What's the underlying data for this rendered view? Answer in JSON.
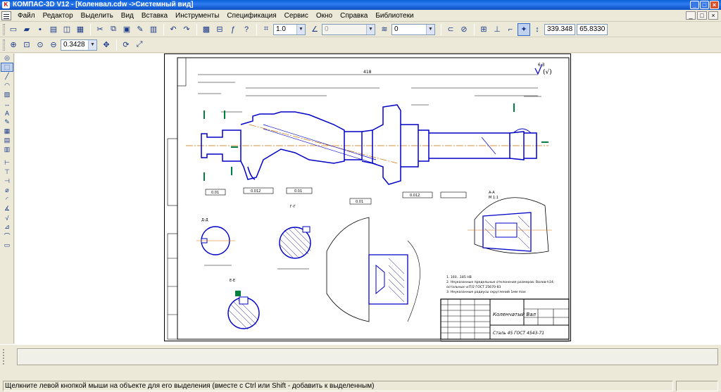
{
  "window": {
    "title": "КОМПАС-3D V12 - [Коленвал.cdw ->Системный вид]",
    "controls": [
      "_",
      "□",
      "×"
    ]
  },
  "menubar": {
    "items": [
      "Файл",
      "Редактор",
      "Выделить",
      "Вид",
      "Вставка",
      "Инструменты",
      "Спецификация",
      "Сервис",
      "Окно",
      "Справка",
      "Библиотеки"
    ]
  },
  "toolbar1": {
    "step_value": "1.0",
    "disabled_value": "0",
    "layer_value": "0",
    "coord_x": "339.348",
    "coord_y": "65.8330"
  },
  "toolbar2": {
    "zoom_value": "0.3428"
  },
  "drawing": {
    "title": "Коленчатый Вал",
    "material": "Сталь 45 ГОСТ 4543-71",
    "roughness": "6,3",
    "overall_length": "418",
    "notes": [
      "1. 160...185 HB",
      "2. Неуказанные предельные отклонения размеров: Валов-h14;",
      "   остальных-±IT/2  ГОСТ 25670-83",
      "3. Неуказанные радиусы скруглений 1мм max"
    ],
    "section_labels": [
      "Д-Д",
      "Г-Г",
      "Е-Е",
      "А-А",
      "Б-Б"
    ],
    "scale_labels": [
      "M 1:1",
      "M 1:1"
    ],
    "tolerance_frames": [
      "0.01",
      "0.012",
      "0.01",
      "0.01",
      "0.012"
    ]
  },
  "statusbar": {
    "hint": "Щелкните левой кнопкой мыши на объекте для его выделения (вместе с Ctrl или Shift - добавить к выделенным)"
  },
  "colors": {
    "titlebar": "#0a5fd8",
    "chrome": "#ece9d8",
    "drawing_line": "#0000c8",
    "axis_line": "#d07000",
    "marker_green": "#008040"
  }
}
